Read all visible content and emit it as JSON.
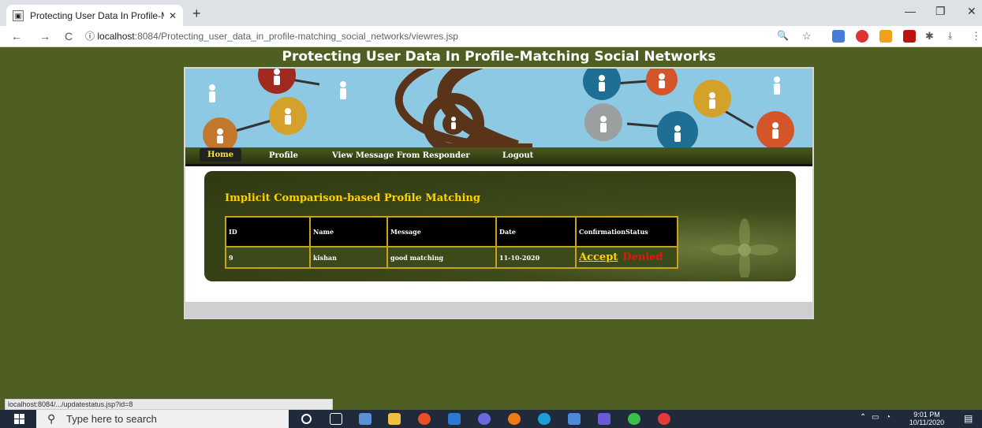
{
  "browser": {
    "tab_title": "Protecting User Data In Profile-M",
    "tab_close": "✕",
    "new_tab": "+",
    "minimize": "—",
    "maximize": "❐",
    "close": "✕",
    "back": "←",
    "forward": "→",
    "reload": "C",
    "info": "ⓘ",
    "url_host": "localhost",
    "url_path": ":8084/Protecting_user_data_in_profile-matching_social_networks/viewres.jsp",
    "status_url": "localhost:8084/.../updatestatus.jsp?id=8"
  },
  "page": {
    "title": "Protecting User Data In Profile-Matching Social Networks",
    "menu": [
      "Home",
      "Profile",
      "View Message From Responder",
      "Logout"
    ],
    "section_heading": "Implicit Comparison-based Profile Matching",
    "table": {
      "headers": [
        "ID",
        "Name",
        "Message",
        "Date",
        "ConfirmationStatus"
      ],
      "rows": [
        {
          "id": "9",
          "name": "kishan",
          "message": "good matching",
          "date": "11-10-2020",
          "accept": "Accept",
          "denied": "Denied"
        }
      ]
    }
  },
  "taskbar": {
    "search_placeholder": "Type here to search",
    "time": "9:01 PM",
    "date": "10/11/2020"
  },
  "colors": {
    "page_bg": "#4f5e22",
    "heading_yellow": "#ffd200",
    "denied_red": "#e11111",
    "table_border": "#c7a21a"
  }
}
